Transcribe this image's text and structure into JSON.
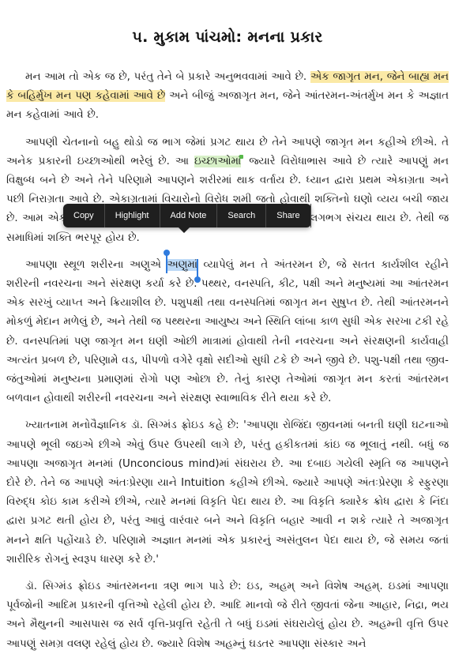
{
  "chapter": {
    "title": "૫. મુકામ પાંચમો: મનના પ્રકાર"
  },
  "p1": {
    "a": "મન આમ તો એક જ છે, પરંતુ તેને બે પ્રકારે અનુભવવામાં આવે છે. ",
    "hl": "એક જાગૃત મન, જેને બાહ્ય મન કે બહિર્મુખ મન પણ કહેવામાં આવે છે",
    "b": " અને બીજું અજાગૃત મન, જેને આંતરમન-અંતર્મુખ મન કે અજ્ઞાત મન કહેવામાં આવે છે."
  },
  "p2": {
    "a": "આપણી ચેતનાનો બહુ થોડો જ ભાગ જેમાં પ્રગટ થાય છે તેને આપણે જાગૃત મન કહીએ છીએ. તે અનેક પ્રકારની ઇચ્છાઓથી ભરેલું છે. આ ",
    "hl": "ઇચ્છાઓમાં",
    "b": " જ્યારે વિરોધાભાસ આવે છે ત્યારે આપણું મન વિક્ષુબ્ધ બને છે અને તેને પરિણામે આપણને શરીરમાં થાક વર્તાય છે. ધ્યાન દ્વારા પ્રથમ એકાગ્રતા અને પછી નિરાગ્રતા આવે છે. એકાગ્રતામાં વિચારોનો વિરોધ શમી જતો હોવાથી શક્તિનો ઘણો વ્યય બચી જાય છે. આમ એકાગ્રતા ઘણી શક્તિ બચાવે છે. જ્યારે નિરાગ્રતામાં શક્તિનો લગભગ સંચય થાય છે. તેથી જ સમાધિમાં શક્તિ ભરપૂર હોય છે."
  },
  "p3": {
    "a": "આપણા સ્થૂળ શરીરના અણુએ ",
    "sel": "અણુમાં",
    "b": " વ્યાપેલું મન તે અંતરમન છે, જે સતત કાર્યશીલ રહીને શરીરની નવરચના અને સંરક્ષણ કર્યા કરે છે. પથ્થર, વનસ્પતિ, કીટ, પક્ષી અને મનુષ્યમાં આ આંતરમન એક સરખું વ્યાપ્ત અને ક્રિયાશીલ છે. પશુપક્ષી તથા વનસ્પતિમાં જાગૃત મન સુષુપ્ત છે. તેથી આંતરમનને મોકળું મેદાન મળેલું છે, અને તેથી જ પથ્થરના આયુષ્ય અને સ્થિતિ લાંબા કાળ સુધી એક સરખા ટકી રહે છે. વનસ્પતિમાં પણ જાગૃત મન ઘણી ઓછી માત્રામાં હોવાથી તેની નવરચના અને સંરક્ષણની કાર્યવાહી અત્યંત પ્રબળ છે, પરિણામે વડ, પીપળો વગેરે વૃક્ષો સદીઓ સુધી ટકે છે અને જીવે છે. પશુ-પક્ષી તથા જીવ-જંતુઓમાં મનુષ્યના પ્રમાણમાં રોગો પણ ઓછા છે. તેનું કારણ તેઓમાં જાગૃત મન કરતાં આંતરમન બળવાન હોવાથી શરીરની નવરચના અને સંરક્ષણ સ્વાભાવિક રીતે થયા કરે છે."
  },
  "p4": {
    "text": "ખ્યાતનામ મનોવૈજ્ઞાનિક ડૉ. સિગ્મંડ ફ્રોઇડ કહે છે: 'આપણા રોજિંદા જીવનમાં બનતી ઘણી ઘટનાઓ આપણે ભૂલી જઇએ છીએ એવું ઉપર ઉપરથી લાગે છે, પરંતુ હકીકતમાં કાંઇ જ ભૂલાતું નથી. બધું જ આપણા અજાગૃત મનમાં (Unconcious mind)માં સંઘરાય છે. આ દબાઇ ગયેલી સ્મૃતિ જ આપણને દોરે છે. તેને જ આપણે અંતઃપ્રેરણા યાને Intuition કહીએ છીએ. જ્યારે આપણે અંતઃપ્રેરણા કે સ્ફુરણા વિરુદ્ધ કોઇ કામ કરીએ છીએ, ત્યારે મનમાં વિકૃતિ પેદા થાય છે. આ વિકૃતિ ક્યારેક ક્રોધ દ્વારા કે નિંદા દ્વારા પ્રગટ થતી હોય છે, પરંતુ આવું વારંવાર બને અને વિકૃતિ બહાર આવી ન શકે ત્યારે તે અજાગૃત મનને ક્ષતિ પહોંચાડે છે. પરિણામે અજ્ઞાત મનમાં એક પ્રકારનું અસંતુલન પેદા થાય છે, જે સમય જતાં શારીરિક રોગનું સ્વરૂપ ધારણ કરે છે.'"
  },
  "p5": {
    "text": "ડૉ. સિગ્મંડ ફ્રોઇડ આંતરમનના ત્રણ ભાગ પાડે છે: ઇડ, અહમ્ અને વિશેષ અહમ્. ઇડમાં આપણા પૂર્વજોની આદિમ પ્રકારની વૃત્તિઓ રહેલી હોય છે. આદિ માનવો જે રીતે જીવતાં જેના આહાર, નિદ્રા, ભય અને મૈથુનની આસપાસ જ સર્વ વૃત્તિ-પ્રવૃત્તિ રહેતી તે બધું ઇડમાં સંઘરાયેલું હોય છે. અહમ્ની વૃત્તિ ઉપર આપણું સમગ્ર વલણ રહેલું હોય છે. જ્યારે વિશેષ અહમ્નું ઘડતર આપણા સંસ્કાર અને"
  },
  "popup": {
    "items": [
      "Copy",
      "Highlight",
      "Add Note",
      "Search",
      "Share"
    ]
  },
  "colors": {
    "highlight_yellow": "#fbe9a6",
    "highlight_green": "#d8f1c8",
    "selection": "#bcd9f6",
    "handle": "#2f7bde",
    "popup_bg": "#1f1f1f"
  }
}
